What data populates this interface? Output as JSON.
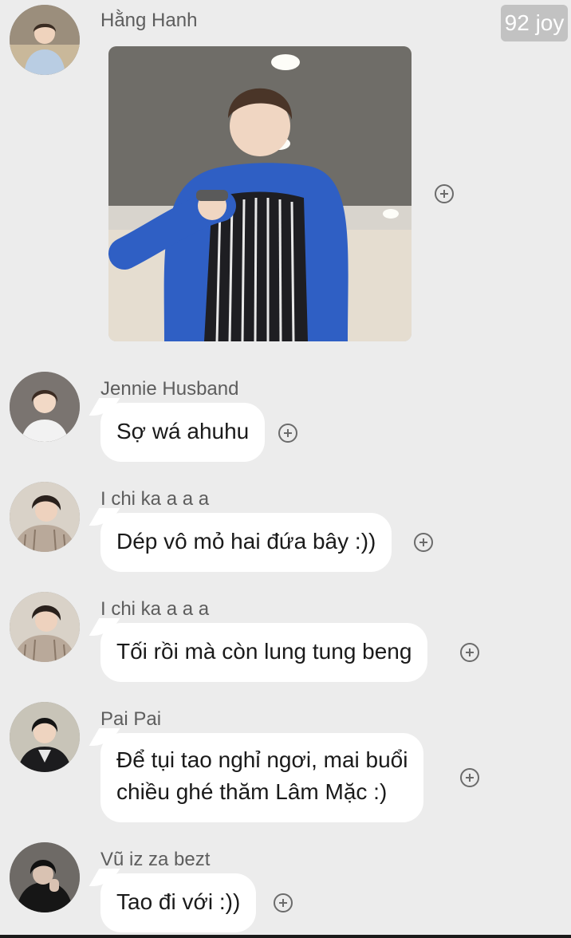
{
  "watermark": "92 joy",
  "messages": [
    {
      "sender": "Hằng Hanh",
      "type": "image",
      "image_desc": "photo",
      "avatar_icon": "avatar-man-light-shirt"
    },
    {
      "sender": "Jennie Husband",
      "type": "text",
      "text": "Sợ wá ahuhu",
      "avatar_icon": "avatar-man-white-shirt"
    },
    {
      "sender": "I chi ka a a a",
      "type": "text",
      "text": "Dép vô mỏ hai đứa bây :))",
      "avatar_icon": "avatar-man-striped-shirt"
    },
    {
      "sender": "I chi ka a a a",
      "type": "text",
      "text": "Tối rồi mà còn lung tung beng",
      "avatar_icon": "avatar-man-striped-shirt"
    },
    {
      "sender": "Pai Pai",
      "type": "text",
      "text_lines": [
        "Để tụi tao nghỉ ngơi, mai buổi",
        "chiều ghé thăm Lâm Mặc :)"
      ],
      "avatar_icon": "avatar-man-black-jacket"
    },
    {
      "sender": "Vũ iz za bezt",
      "type": "text",
      "text": "Tao đi với :))",
      "avatar_icon": "avatar-man-dark-hood"
    }
  ],
  "colors": {
    "background": "#ececec",
    "bubble": "#ffffff",
    "sender_text": "#5d5d5d"
  }
}
